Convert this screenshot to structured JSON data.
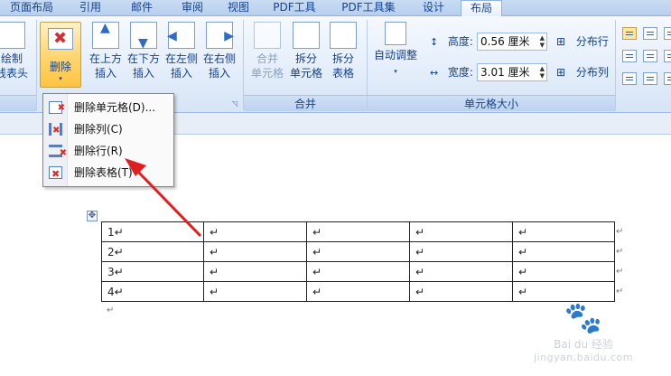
{
  "tabs": [
    {
      "label": "页面布局",
      "active": false
    },
    {
      "label": "引用",
      "active": false
    },
    {
      "label": "邮件",
      "active": false
    },
    {
      "label": "审阅",
      "active": false
    },
    {
      "label": "视图",
      "active": false
    },
    {
      "label": "PDF工具",
      "active": false
    },
    {
      "label": "PDF工具集",
      "active": false
    },
    {
      "label": "设计",
      "active": false
    },
    {
      "label": "布局",
      "active": true
    }
  ],
  "ribbon": {
    "draw": {
      "line1": "绘制",
      "line2": "线表头"
    },
    "delete": {
      "label": "删除",
      "caret": "▾"
    },
    "insert": [
      {
        "line1": "在上方",
        "line2": "插入"
      },
      {
        "line1": "在下方",
        "line2": "插入"
      },
      {
        "line1": "在左侧",
        "line2": "插入"
      },
      {
        "line1": "在右侧",
        "line2": "插入"
      }
    ],
    "merge": {
      "group_label": "合并",
      "merge_cells": {
        "line1": "合并",
        "line2": "单元格"
      },
      "split_cells": {
        "line1": "拆分",
        "line2": "单元格"
      },
      "split_table": {
        "line1": "拆分",
        "line2": "表格"
      }
    },
    "cell_size": {
      "group_label": "单元格大小",
      "autofit": {
        "label": "自动调整",
        "caret": "▾"
      },
      "height_label": "高度:",
      "height_value": "0.56 厘米",
      "width_label": "宽度:",
      "width_value": "3.01 厘米",
      "distribute_rows": "分布行",
      "distribute_cols": "分布列"
    },
    "launcher_symbol": "◹"
  },
  "menu": {
    "items": [
      {
        "text": "删除单元格(D)...",
        "icon": "delete-cells-icon"
      },
      {
        "text": "删除列(C)",
        "icon": "delete-column-icon"
      },
      {
        "text": "删除行(R)",
        "icon": "delete-row-icon"
      },
      {
        "text": "删除表格(T)",
        "icon": "delete-table-icon"
      }
    ]
  },
  "document": {
    "rows": [
      [
        "1↵",
        "↵",
        "↵",
        "↵",
        "↵"
      ],
      [
        "2↵",
        "↵",
        "↵",
        "↵",
        "↵"
      ],
      [
        "3↵",
        "↵",
        "↵",
        "↵",
        "↵"
      ],
      [
        "4↵",
        "↵",
        "↵",
        "↵",
        "↵"
      ]
    ],
    "end_mark": "↵",
    "move_handle": "✥"
  },
  "watermark": {
    "brand": "Bai du 经验",
    "site": "jingyan.baidu.com"
  },
  "colors": {
    "accent": "#15428b",
    "arrow": "#e02020",
    "highlight": "#ffd775"
  }
}
